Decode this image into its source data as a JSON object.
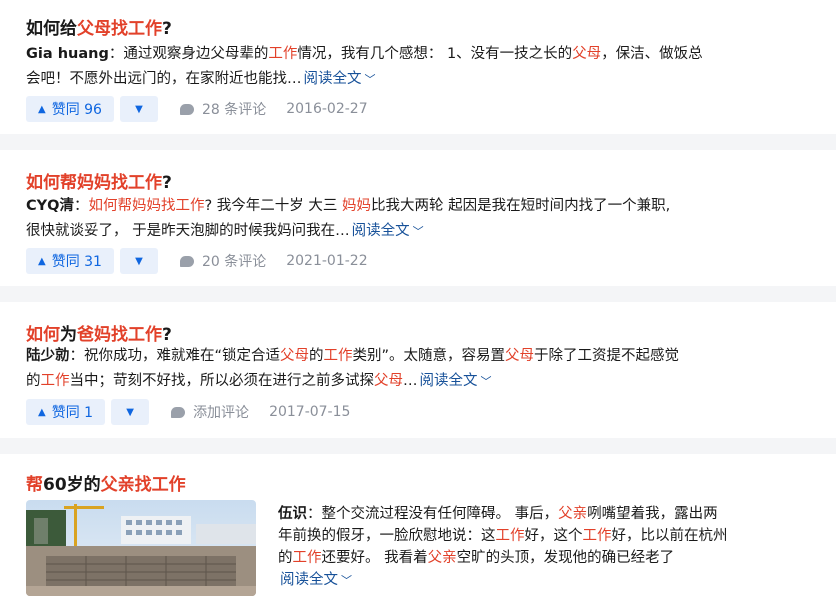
{
  "colors": {
    "highlight": "#e2412a",
    "link": "#175199",
    "vote": "#0f66e0",
    "vote_bg": "#e9f0fb",
    "meta": "#8a8f99"
  },
  "read_more": "阅读全文",
  "results": [
    {
      "title": [
        "如何",
        "给",
        "父母找工作",
        "?"
      ],
      "author": "Gia huang",
      "excerpt": [
        "：通过观察身边父母辈的",
        "工作",
        "情况，我有几个感想： 1、没有一技之长的",
        "父母",
        "，保洁、做饭总",
        "会吧！不愿外出远门的，在家附近也能找…"
      ],
      "vote_up": "赞同 96",
      "comments": "28 条评论",
      "date": "2016-02-27"
    },
    {
      "title": [
        "如何帮妈妈找工作",
        "?"
      ],
      "author": "CYQ清",
      "excerpt": [
        "：",
        "如何帮妈妈找工作",
        "? 我今年二十岁 大三 ",
        "妈妈",
        "比我大两轮 起因是我在短时间内找了一个兼职,",
        "很快就谈妥了， 于是昨天泡脚的时候我妈问我在…"
      ],
      "vote_up": "赞同 31",
      "comments": "20 条评论",
      "date": "2021-01-22"
    },
    {
      "title": [
        "如何",
        "为",
        "爸妈找工作",
        "?"
      ],
      "author": "陆少勍",
      "excerpt": [
        "：祝你成功，难就难在“锁定合适",
        "父母",
        "的",
        "工作",
        "类别”。太随意，容易置",
        "父母",
        "于除了工资提不起感觉",
        "的",
        "工作",
        "当中；苛刻不好找，所以必须在进行之前多试探",
        "父母",
        "…"
      ],
      "vote_up": "赞同 1",
      "comments": "添加评论",
      "date": "2017-07-15"
    },
    {
      "title": [
        "帮",
        "60岁的",
        "父亲找工作"
      ],
      "author": "伍识",
      "excerpt": [
        "：整个交流过程没有任何障碍。 事后，",
        "父亲",
        "咧嘴望着我，露出两",
        "年前换的假牙，一脸欣慰地说：这",
        "工作",
        "好，这个",
        "工作",
        "好，比以前在杭州",
        "的",
        "工作",
        "还要好。 我看着",
        "父亲",
        "空旷的头顶，发现他的确已经老了"
      ],
      "image_alt": "construction-site-photo"
    }
  ]
}
